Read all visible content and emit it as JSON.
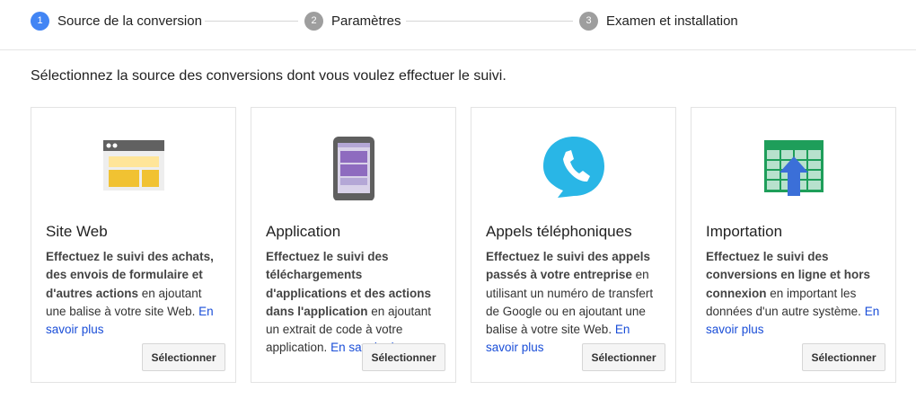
{
  "stepper": {
    "steps": [
      {
        "number": "1",
        "label": "Source de la conversion",
        "state": "active"
      },
      {
        "number": "2",
        "label": "Paramètres",
        "state": "inactive"
      },
      {
        "number": "3",
        "label": "Examen et installation",
        "state": "inactive"
      }
    ]
  },
  "intro": "Sélectionnez la source des conversions dont vous voulez effectuer le suivi.",
  "cards": [
    {
      "icon": "browser-window-icon",
      "title": "Site Web",
      "bold": "Effectuez le suivi des achats, des envois de formulaire et d'autres actions",
      "rest": " en ajoutant une balise à votre site Web. ",
      "more": "En savoir plus",
      "button": "Sélectionner"
    },
    {
      "icon": "mobile-phone-icon",
      "title": "Application",
      "bold": "Effectuez le suivi des téléchargements d'applications et des actions dans l'application",
      "rest": " en ajoutant un extrait de code à votre application. ",
      "more": "En savoir plus",
      "button": "Sélectionner"
    },
    {
      "icon": "phone-call-icon",
      "title": "Appels téléphoniques",
      "bold": "Effectuez le suivi des appels passés à votre entreprise",
      "rest": " en utilisant un numéro de transfert de Google ou en ajoutant une balise à votre site Web. ",
      "more": "En savoir plus",
      "button": "Sélectionner"
    },
    {
      "icon": "spreadsheet-upload-icon",
      "title": "Importation",
      "bold": "Effectuez le suivi des conversions en ligne et hors connexion",
      "rest": " en important les données d'un autre système. ",
      "more": "En savoir plus",
      "button": "Sélectionner"
    }
  ],
  "colors": {
    "active_step": "#4285f4",
    "inactive_step": "#9e9e9e",
    "link": "#1a4ed8",
    "web_icon_yellow": "#f1c232",
    "app_icon_purple": "#8e6bbf",
    "call_icon_blue": "#29b6e6",
    "import_icon_green": "#1e9e5a",
    "import_arrow_blue": "#3b6fd8"
  }
}
